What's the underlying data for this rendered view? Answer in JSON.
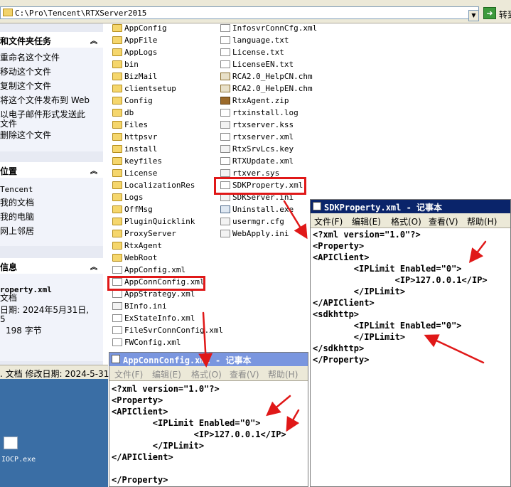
{
  "address_bar": {
    "path": "C:\\Pro\\Tencent\\RTXServer2015",
    "go_label": "转到"
  },
  "task_pane": {
    "file_tasks": {
      "title": "和文件夹任务",
      "items": [
        "重命名这个文件",
        "移动这个文件",
        "复制这个文件",
        "将这个文件发布到 Web",
        "以电子邮件形式发送此",
        "文件",
        "删除这个文件"
      ]
    },
    "other_places": {
      "title": "位置",
      "items": [
        "Tencent",
        "我的文档",
        "我的电脑",
        "网上邻居"
      ]
    },
    "details": {
      "title": "信息",
      "name": "roperty.xml",
      "type": "文档",
      "modified": "日期: 2024年5月31日,",
      "modified_cont": "5",
      "size": "198 字节"
    }
  },
  "status_bar": {
    "text": ". 文档 修改日期: 2024-5-31"
  },
  "desktop": {
    "icon_label": "IOCP.exe"
  },
  "files_col1": [
    {
      "name": "AppConfig",
      "type": "folder"
    },
    {
      "name": "AppFile",
      "type": "folder"
    },
    {
      "name": "AppLogs",
      "type": "folder"
    },
    {
      "name": "bin",
      "type": "folder"
    },
    {
      "name": "BizMail",
      "type": "folder"
    },
    {
      "name": "clientsetup",
      "type": "folder"
    },
    {
      "name": "Config",
      "type": "folder"
    },
    {
      "name": "db",
      "type": "folder"
    },
    {
      "name": "Files",
      "type": "folder"
    },
    {
      "name": "httpsvr",
      "type": "folder"
    },
    {
      "name": "install",
      "type": "folder"
    },
    {
      "name": "keyfiles",
      "type": "folder"
    },
    {
      "name": "License",
      "type": "folder"
    },
    {
      "name": "LocalizationRes",
      "type": "folder"
    },
    {
      "name": "Logs",
      "type": "folder"
    },
    {
      "name": "OffMsg",
      "type": "folder"
    },
    {
      "name": "PluginQuicklink",
      "type": "folder"
    },
    {
      "name": "ProxyServer",
      "type": "folder"
    },
    {
      "name": "RtxAgent",
      "type": "folder"
    },
    {
      "name": "WebRoot",
      "type": "folder"
    },
    {
      "name": "AppConfig.xml",
      "type": "xml"
    },
    {
      "name": "AppConnConfig.xml",
      "type": "xml"
    },
    {
      "name": "AppStrategy.xml",
      "type": "xml"
    },
    {
      "name": "BInfo.ini",
      "type": "other"
    },
    {
      "name": "ExStateInfo.xml",
      "type": "xml"
    },
    {
      "name": "FileSvrConnConfig.xml",
      "type": "xml"
    },
    {
      "name": "FWConfig.xml",
      "type": "xml"
    }
  ],
  "files_col2": [
    {
      "name": "InfosvrConnCfg.xml",
      "type": "xml"
    },
    {
      "name": "language.txt",
      "type": "txt"
    },
    {
      "name": "License.txt",
      "type": "txt"
    },
    {
      "name": "LicenseEN.txt",
      "type": "txt"
    },
    {
      "name": "RCA2.0_HelpCN.chm",
      "type": "chm"
    },
    {
      "name": "RCA2.0_HelpEN.chm",
      "type": "chm"
    },
    {
      "name": "RtxAgent.zip",
      "type": "zip"
    },
    {
      "name": "rtxinstall.log",
      "type": "txt"
    },
    {
      "name": "rtxserver.kss",
      "type": "other"
    },
    {
      "name": "rtxserver.xml",
      "type": "xml"
    },
    {
      "name": "RtxSrvLcs.key",
      "type": "other"
    },
    {
      "name": "RTXUpdate.xml",
      "type": "xml"
    },
    {
      "name": "rtxver.sys",
      "type": "other"
    },
    {
      "name": "SDKProperty.xml",
      "type": "xml"
    },
    {
      "name": "SDKServer.ini",
      "type": "other"
    },
    {
      "name": "Uninstall.exe",
      "type": "exe"
    },
    {
      "name": "usermgr.cfg",
      "type": "other"
    },
    {
      "name": "WebApply.ini",
      "type": "other"
    }
  ],
  "notepad_sdk": {
    "title": "SDKProperty.xml - 记事本",
    "menu": [
      "文件(F)",
      "编辑(E)",
      "格式(O)",
      "查看(V)",
      "帮助(H)"
    ],
    "lines": [
      "<?xml version=\"1.0\"?>",
      "<Property>",
      "<APIClient>",
      "        <IPLimit Enabled=\"0\">",
      "                <IP>127.0.0.1</IP>",
      "        </IPLimit>",
      "</APIClient>",
      "<sdkhttp>",
      "        <IPLimit Enabled=\"0\">",
      "        </IPLimit>",
      "</sdkhttp>",
      "</Property>"
    ]
  },
  "notepad_appconn": {
    "title": "AppConnConfig.xml - 记事本",
    "menu": [
      "文件(F)",
      "编辑(E)",
      "格式(O)",
      "查看(V)",
      "帮助(H)"
    ],
    "lines": [
      "<?xml version=\"1.0\"?>",
      "<Property>",
      "<APIClient>",
      "        <IPLimit Enabled=\"0\">",
      "                <IP>127.0.0.1</IP>",
      "        </IPLimit>",
      "</APIClient>",
      "",
      "</Property>"
    ]
  },
  "colors": {
    "title_active": "#0a246a",
    "title_inactive": "#7a96df",
    "annotation_red": "#e01818",
    "desktop_blue": "#3a6ea5"
  }
}
